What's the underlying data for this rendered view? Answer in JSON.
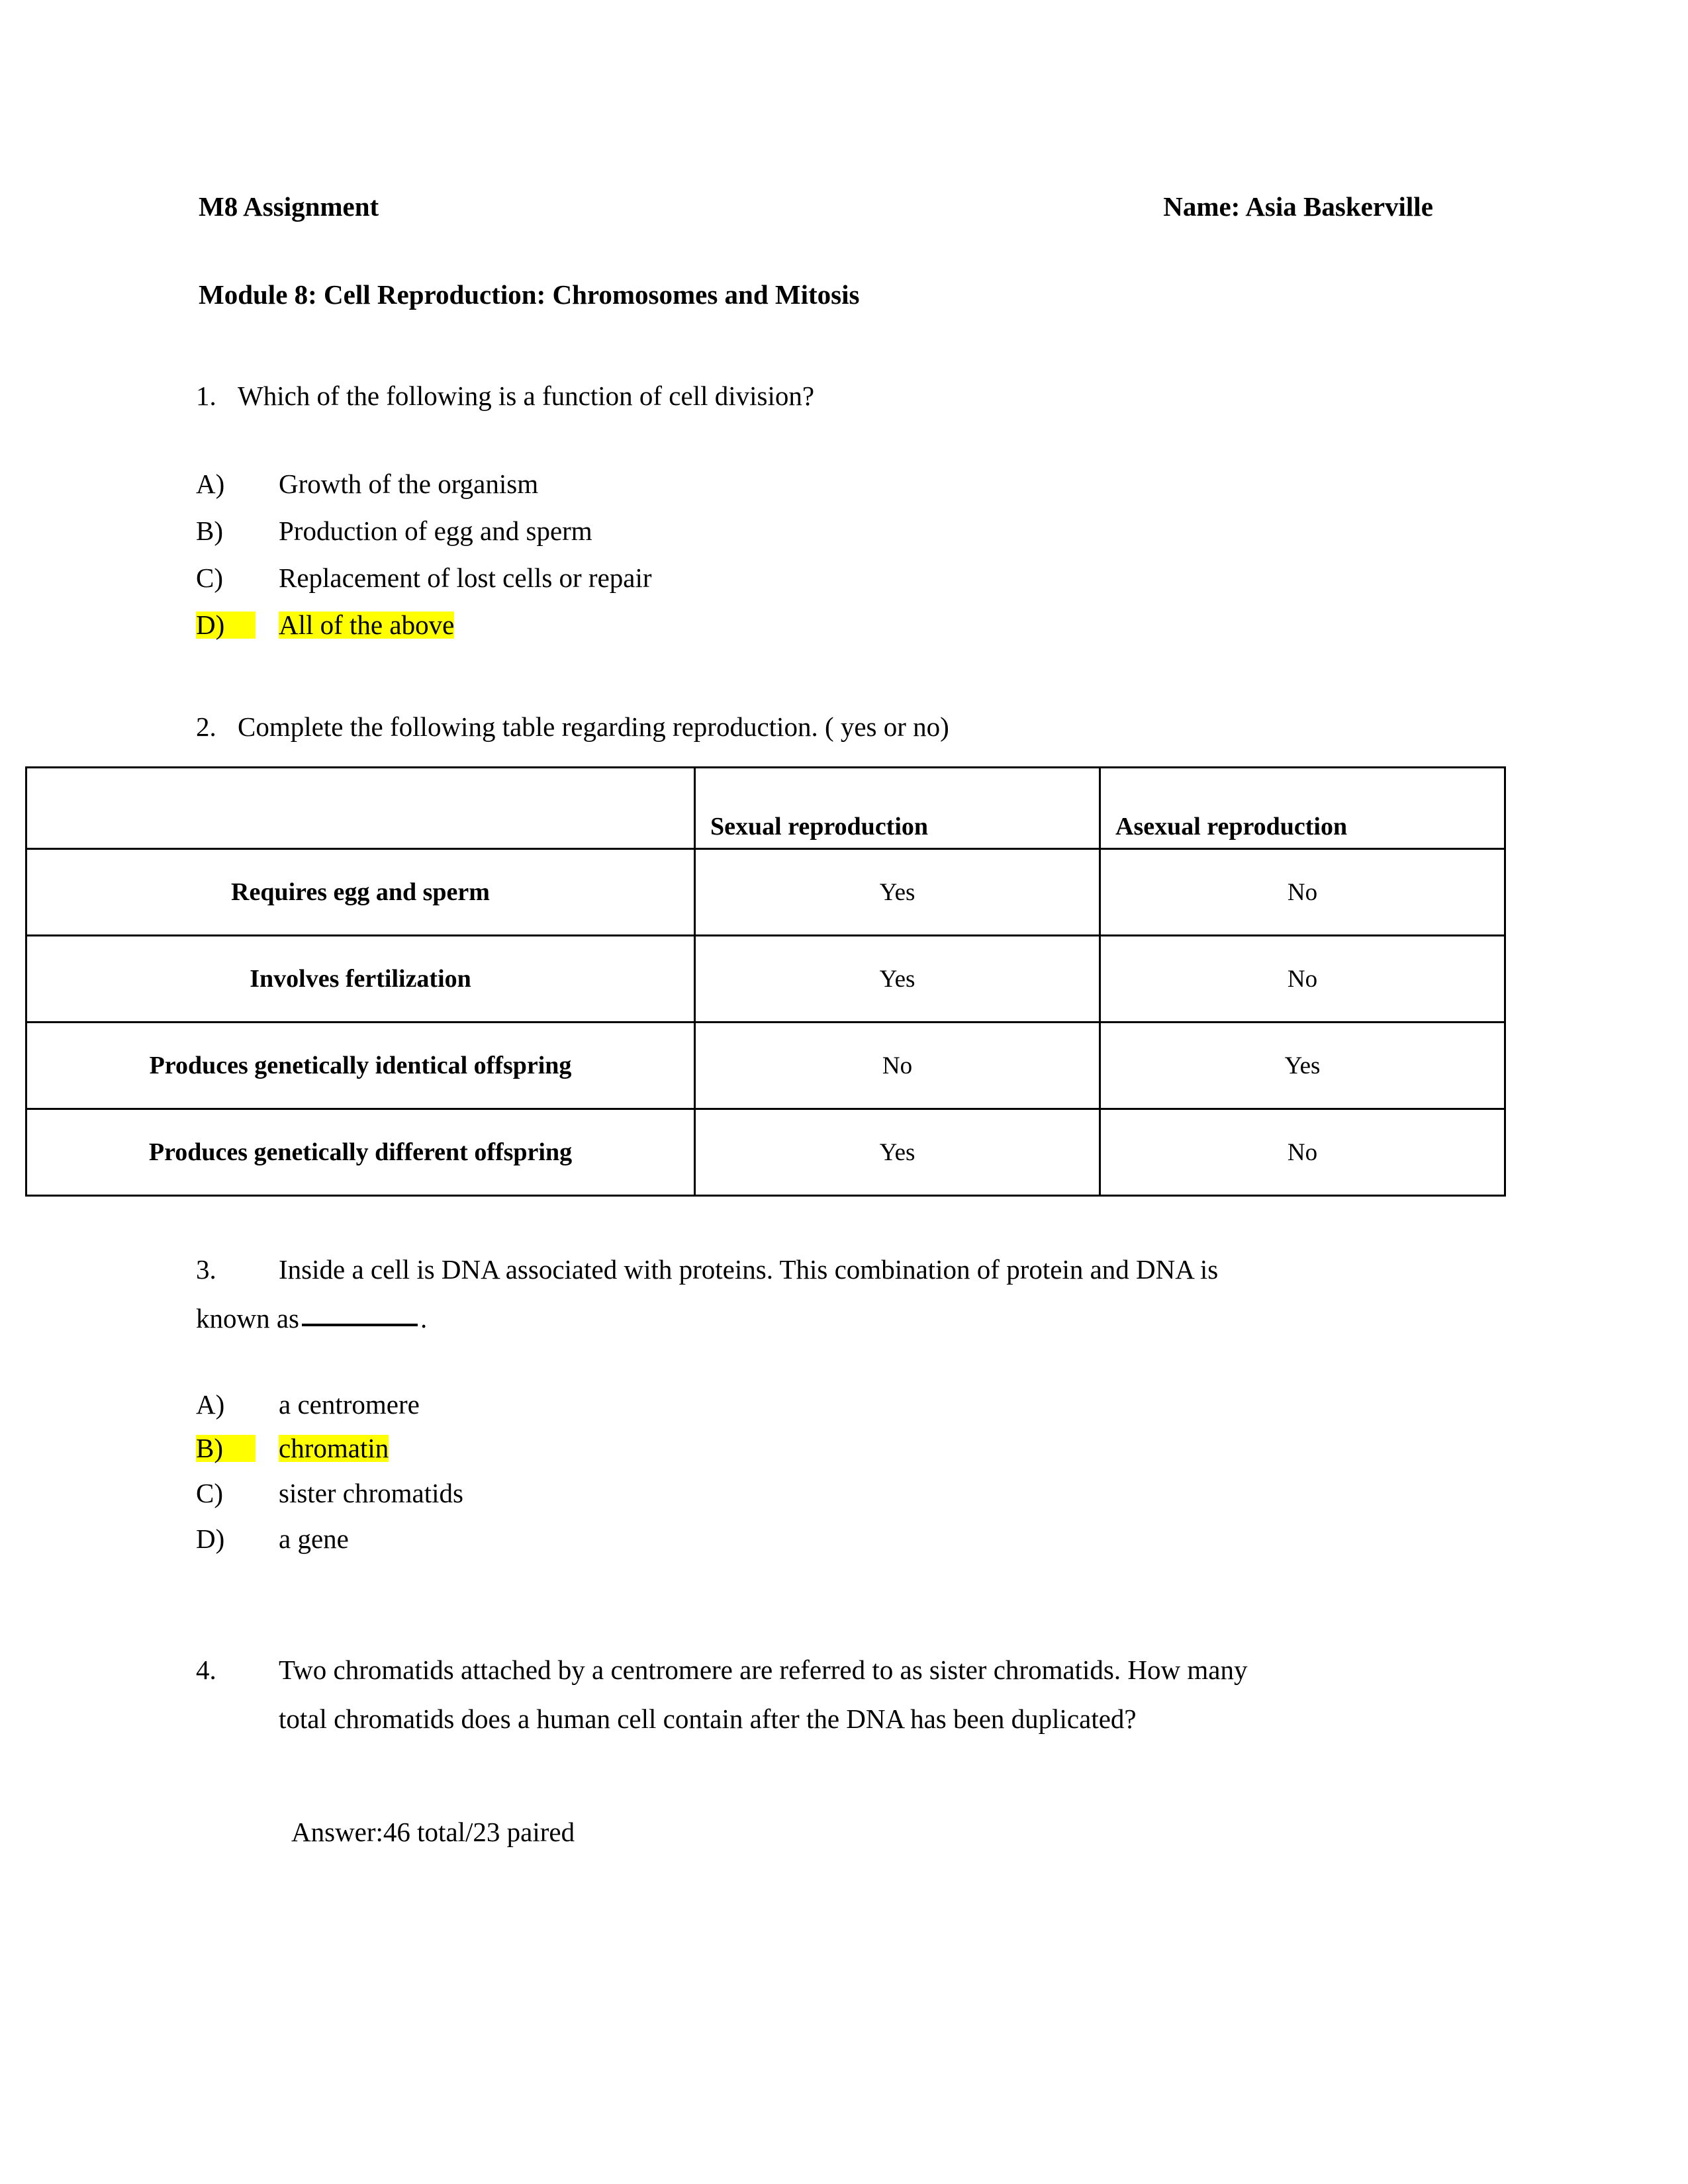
{
  "document": {
    "header": {
      "assignment_label": "M8 Assignment",
      "name_label": "Name: Asia Baskerville"
    },
    "module_title": "Module 8: Cell Reproduction: Chromosomes and Mitosis",
    "questions": [
      {
        "number": "1.",
        "stem": "Which of the following is a function of cell division?",
        "options": [
          {
            "label": "A)",
            "text": "Growth of the organism",
            "highlighted": false
          },
          {
            "label": "B)",
            "text": "Production of egg and sperm",
            "highlighted": false
          },
          {
            "label": "C)",
            "text": "Replacement of lost cells or repair",
            "highlighted": false
          },
          {
            "label": "D)",
            "text": "All of the above",
            "highlighted": true
          }
        ]
      },
      {
        "number": "2.",
        "stem": "Complete the following table regarding reproduction. ( yes or no)",
        "table": {
          "corner_header": "",
          "columns": [
            "Sexual reproduction",
            "Asexual reproduction"
          ],
          "rows": [
            {
              "label": "Requires egg and sperm",
              "values": [
                "Yes",
                "No"
              ]
            },
            {
              "label": "Involves fertilization",
              "values": [
                "Yes",
                "No"
              ]
            },
            {
              "label": "Produces genetically identical offspring",
              "values": [
                "No",
                "Yes"
              ]
            },
            {
              "label": "Produces genetically different offspring",
              "values": [
                "Yes",
                "No"
              ]
            }
          ]
        }
      },
      {
        "number": "3.",
        "stem_line_1": "Inside a cell is DNA associated with proteins. This combination of protein and DNA is",
        "stem_line_2_before": "known as",
        "stem_line_2_after": ".",
        "options": [
          {
            "label": "A)",
            "text": "a centromere",
            "highlighted": false
          },
          {
            "label": "B)",
            "text": "chromatin",
            "highlighted": true
          },
          {
            "label": "C)",
            "text": "sister chromatids",
            "highlighted": false
          },
          {
            "label": "D)",
            "text": "a gene",
            "highlighted": false
          }
        ]
      },
      {
        "number": "4.",
        "stem_line_1": "Two chromatids attached by a centromere are referred to as sister chromatids. How many",
        "stem_line_2": "total chromatids does a human cell contain after the DNA has been duplicated?",
        "answer": "Answer:46 total/23 paired"
      }
    ]
  },
  "colors": {
    "highlight": "#ffff00",
    "text": "#000000",
    "page_background": "#ffffff",
    "table_border": "#000000"
  }
}
